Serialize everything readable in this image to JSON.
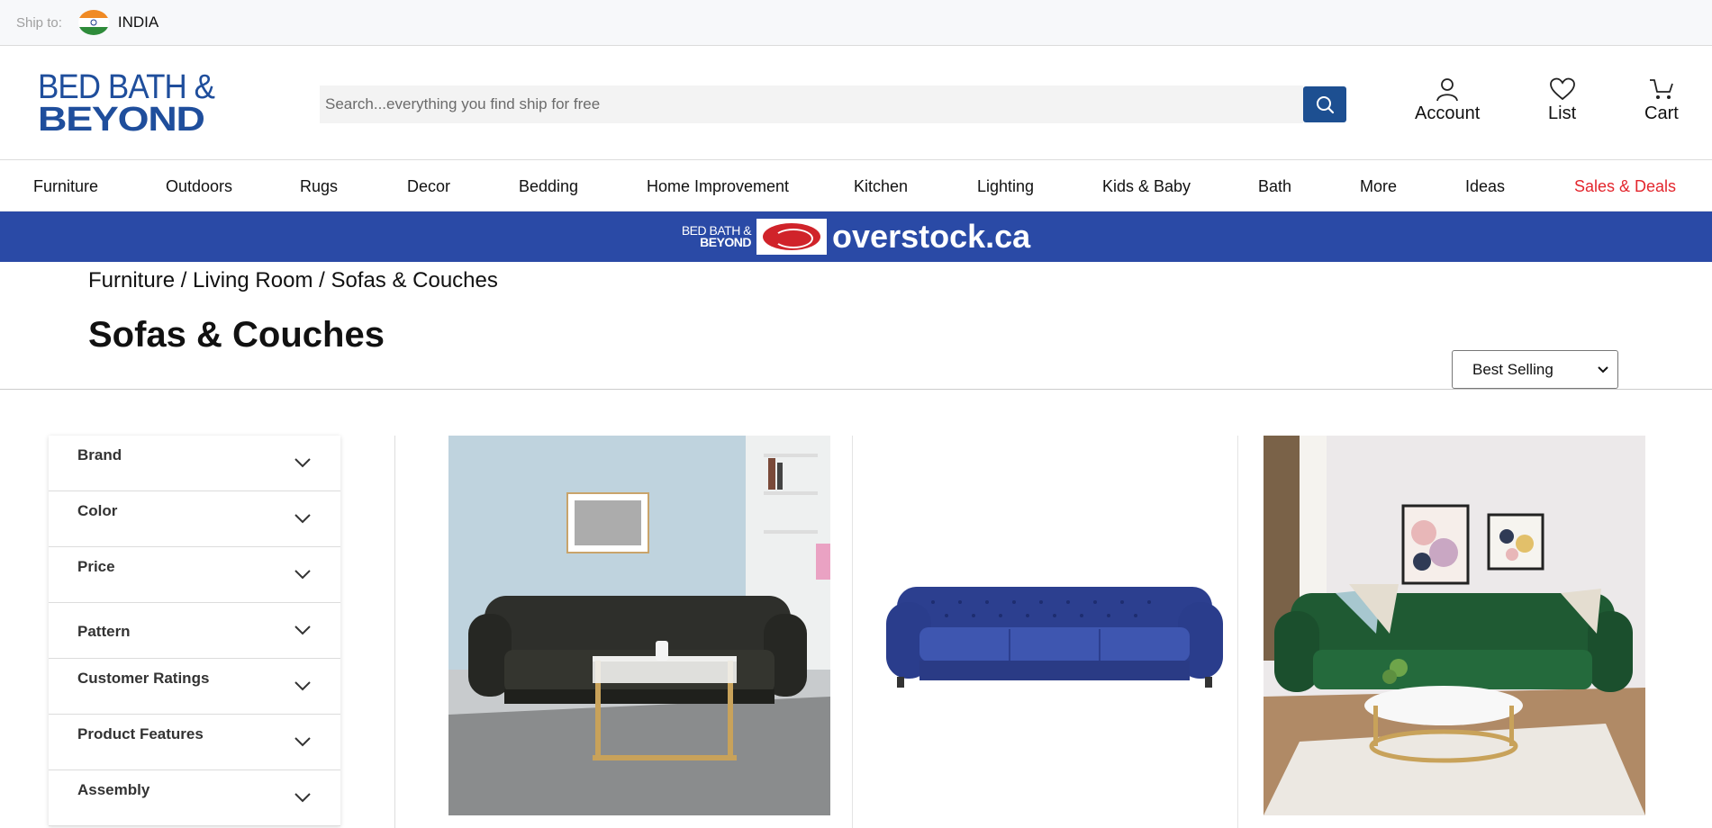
{
  "ship_bar": {
    "label": "Ship to:",
    "country": "INDIA"
  },
  "header": {
    "logo_line1": "BED BATH &",
    "logo_line2": "BEYOND",
    "search_placeholder": "Search...everything you find ship for free",
    "account_label": "Account",
    "list_label": "List",
    "cart_label": "Cart"
  },
  "nav": {
    "items": [
      "Furniture",
      "Outdoors",
      "Rugs",
      "Decor",
      "Bedding",
      "Home Improvement",
      "Kitchen",
      "Lighting",
      "Kids & Baby",
      "Bath",
      "More",
      "Ideas",
      "Sales & Deals"
    ]
  },
  "banner": {
    "bbb_line1": "BED BATH &",
    "bbb_line2": "BEYOND",
    "site": "overstock.ca"
  },
  "page": {
    "breadcrumb": "Furniture / Living Room / Sofas & Couches",
    "title": "Sofas & Couches",
    "sort_selected": "Best Selling"
  },
  "filters": [
    "Brand",
    "Color",
    "Price",
    "Pattern",
    "Customer Ratings",
    "Product Features",
    "Assembly"
  ],
  "colors": {
    "brand_blue": "#1f4e9c",
    "banner_blue": "#2a4aa6",
    "deals_red": "#e3262d",
    "search_button": "#1d4f91"
  },
  "products": [
    {
      "image": "black-velvet-chesterfield-sofa-living-room"
    },
    {
      "image": "blue-tufted-velvet-sofa"
    },
    {
      "image": "green-tufted-velvet-sofa-living-room"
    }
  ]
}
